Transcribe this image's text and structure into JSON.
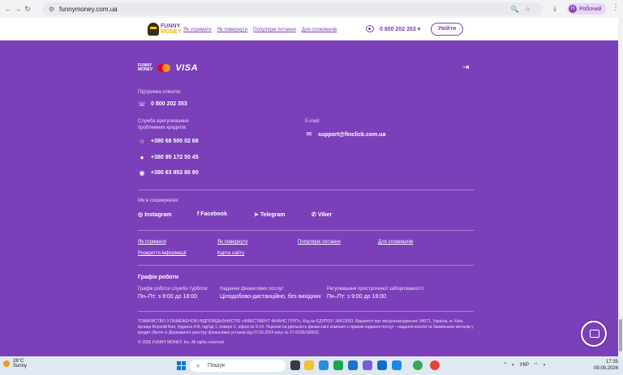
{
  "browser": {
    "url": "funnymoney.com.ua",
    "profile_label": "Робочий",
    "profile_initial": "Н"
  },
  "site_header": {
    "logo_line1": "FUNNY",
    "logo_line2": "MONEY",
    "nav": [
      "Як отримати",
      "Як повернути",
      "Популярні питання",
      "Для споживачів"
    ],
    "phone": "0 800 202 353",
    "login_label": "Увійти"
  },
  "footer": {
    "payment_logos": [
      "mastercard",
      "VISA"
    ],
    "support_label": "Підтримка клієнтів:",
    "support_phone": "0 800 202 353",
    "debt_label": "Служба врегулювання проблемних кредитів:",
    "debt_phones": [
      "+380 68 500 02 68",
      "+380 95 172 50 45",
      "+380 63 853 80 90"
    ],
    "email_label": "E-mail:",
    "email": "support@finclick.com.ua",
    "social_label": "Ми в соцмережах:",
    "social": [
      "Instagram",
      "Facebook",
      "Telegram",
      "Viber"
    ],
    "links_row1": [
      "Як отримати",
      "Як повернути",
      "Популярні питання",
      "Для споживачів"
    ],
    "links_row2": [
      "Розкриття інформації",
      "Карта сайту"
    ],
    "schedule_title": "Графік роботи",
    "schedule": [
      {
        "label": "Графік роботи служби турботи:",
        "value": "Пн–Пт: з 9:00 до 18:00"
      },
      {
        "label": "Надання фінансових послуг:",
        "value": "Цілодобово-дистанційно, без вихідних"
      },
      {
        "label": "Регулювання простроченої заборгованості:",
        "value": "Пн–Пт: з 9:00 до 18:00"
      }
    ],
    "legal": "ТОВАРИСТВО З ОБМЕЖЕНОЮ ВІДПОВІДАЛЬНІСТЮ «ІНВЕСТМЕНТ ФІНАНС ГРУП», Код за ЄДРПОУ: 38413053. Відомості про місцезнаходження: 04071, Україна, м. Київ, вулиця Верхній Вал, будинок 4-В, під'їзд 1, поверх 2, офіси № 9-14. Ліцензія на діяльність фінансової компанії з правом надання послуг - надання коштів та банківських металів у кредит (Витяг із Державного реєстру фінансових установ від 07.03.2024 року № 27-0026/18063).",
    "copyright": "© 2026 FUNNY MONEY, Inc. All rights reserved."
  },
  "taskbar": {
    "temp": "26°C",
    "weather": "Sunny",
    "search_placeholder": "Пошук",
    "lang": "УКР",
    "time": "17:35",
    "date": "09.09.2026"
  }
}
